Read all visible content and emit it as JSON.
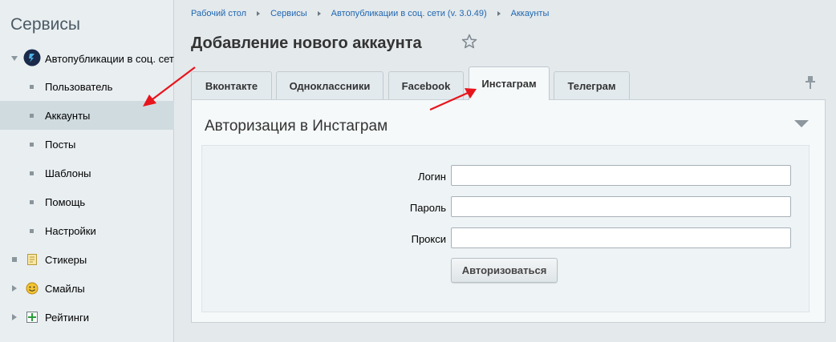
{
  "sidebar": {
    "title": "Сервисы",
    "items": [
      {
        "label": "Автопубликации в соц. сети"
      },
      {
        "label": "Пользователь"
      },
      {
        "label": "Аккаунты"
      },
      {
        "label": "Посты"
      },
      {
        "label": "Шаблоны"
      },
      {
        "label": "Помощь"
      },
      {
        "label": "Настройки"
      },
      {
        "label": "Стикеры"
      },
      {
        "label": "Смайлы"
      },
      {
        "label": "Рейтинги"
      }
    ]
  },
  "breadcrumb": [
    "Рабочий стол",
    "Сервисы",
    "Автопубликации в соц. сети (v. 3.0.49)",
    "Аккаунты"
  ],
  "page_title": "Добавление нового аккаунта",
  "tabs": [
    {
      "label": "Вконтакте"
    },
    {
      "label": "Одноклассники"
    },
    {
      "label": "Facebook"
    },
    {
      "label": "Инстаграм"
    },
    {
      "label": "Телеграм"
    }
  ],
  "active_tab": "Инстаграм",
  "panel": {
    "heading": "Авторизация в Инстаграм",
    "fields": [
      {
        "label": "Логин",
        "value": ""
      },
      {
        "label": "Пароль",
        "value": ""
      },
      {
        "label": "Прокси",
        "value": ""
      }
    ],
    "submit_label": "Авторизоваться"
  },
  "colors": {
    "link": "#2067b0",
    "annotation_arrow": "#e8141c",
    "active_sidebar": "#d0dbe0"
  }
}
